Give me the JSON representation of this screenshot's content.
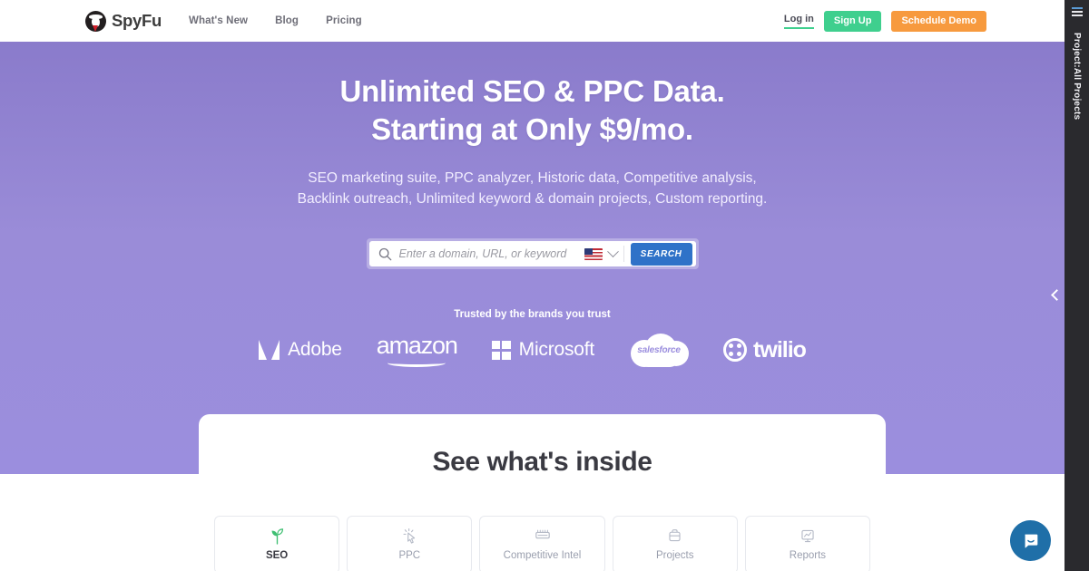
{
  "header": {
    "logo_text": "SpyFu",
    "logo_icon": "spy-badge-icon",
    "nav": [
      {
        "label": "What's New"
      },
      {
        "label": "Blog"
      },
      {
        "label": "Pricing"
      }
    ],
    "login_label": "Log in",
    "signup_label": "Sign Up",
    "demo_label": "Schedule Demo",
    "colors": {
      "signup_bg": "#3fcf8e",
      "demo_bg": "#f79a3e",
      "login_underline": "#3fcf8e"
    }
  },
  "hero": {
    "headline_line1": "Unlimited SEO & PPC Data.",
    "headline_line2": "Starting at Only $9/mo.",
    "subtitle_line1": "SEO marketing suite, PPC analyzer, Historic data, Competitive analysis,",
    "subtitle_line2": "Backlink outreach, Unlimited keyword & domain projects, Custom reporting.",
    "background_gradient_top": "#8a7bcb",
    "background_gradient_bottom": "#9b8ede",
    "search": {
      "placeholder": "Enter a domain, URL, or keyword",
      "value": "",
      "icon": "search-icon",
      "country": "US",
      "country_icon": "us-flag-icon",
      "dropdown_icon": "chevron-down-icon",
      "button_label": "SEARCH",
      "button_color": "#2f72c8"
    },
    "trusted_label": "Trusted by the brands you trust",
    "brands": [
      {
        "name": "Adobe",
        "icon": "adobe-logo-icon"
      },
      {
        "name": "amazon",
        "icon": "amazon-logo-icon"
      },
      {
        "name": "Microsoft",
        "icon": "microsoft-logo-icon"
      },
      {
        "name": "salesforce",
        "icon": "salesforce-logo-icon"
      },
      {
        "name": "twilio",
        "icon": "twilio-logo-icon"
      }
    ]
  },
  "card": {
    "title": "See what's inside",
    "tabs": [
      {
        "label": "SEO",
        "icon": "sprout-icon",
        "active": true
      },
      {
        "label": "PPC",
        "icon": "click-cursor-icon",
        "active": false
      },
      {
        "label": "Competitive Intel",
        "icon": "binoculars-icon",
        "active": false
      },
      {
        "label": "Projects",
        "icon": "briefcase-icon",
        "active": false
      },
      {
        "label": "Reports",
        "icon": "presentation-chart-icon",
        "active": false
      }
    ]
  },
  "rail": {
    "menu_icon": "hamburger-menu-icon",
    "project_label": "Project:All Projects",
    "collapse_icon": "chevron-left-icon"
  },
  "chat": {
    "icon": "chat-bubble-icon",
    "color": "#1f6fa8"
  }
}
